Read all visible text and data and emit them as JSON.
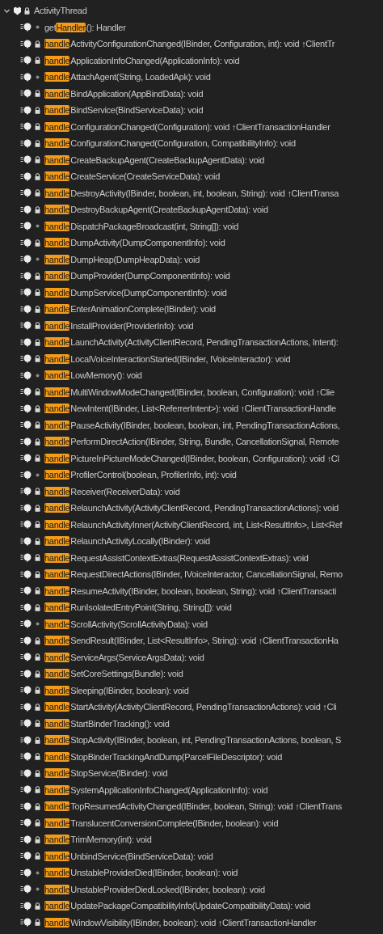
{
  "tree": {
    "label": "ActivityThread",
    "expanded": true,
    "private": true,
    "children": [
      {
        "prefix": "get",
        "match": "Handler",
        "rest": "(): Handler",
        "private": false
      },
      {
        "match": "handle",
        "rest": "ActivityConfigurationChanged(IBinder, Configuration, int): void ↑ClientTr",
        "private": true
      },
      {
        "match": "handle",
        "rest": "ApplicationInfoChanged(ApplicationInfo): void",
        "private": true
      },
      {
        "match": "handle",
        "rest": "AttachAgent(String, LoadedApk): void",
        "private": false
      },
      {
        "match": "handle",
        "rest": "BindApplication(AppBindData): void",
        "private": true
      },
      {
        "match": "handle",
        "rest": "BindService(BindServiceData): void",
        "private": true
      },
      {
        "match": "handle",
        "rest": "ConfigurationChanged(Configuration): void ↑ClientTransactionHandler",
        "private": true
      },
      {
        "match": "handle",
        "rest": "ConfigurationChanged(Configuration, CompatibilityInfo): void",
        "private": true
      },
      {
        "match": "handle",
        "rest": "CreateBackupAgent(CreateBackupAgentData): void",
        "private": true
      },
      {
        "match": "handle",
        "rest": "CreateService(CreateServiceData): void",
        "private": true
      },
      {
        "match": "handle",
        "rest": "DestroyActivity(IBinder, boolean, int, boolean, String): void ↑ClientTransa",
        "private": true
      },
      {
        "match": "handle",
        "rest": "DestroyBackupAgent(CreateBackupAgentData): void",
        "private": true
      },
      {
        "match": "handle",
        "rest": "DispatchPackageBroadcast(int, String[]): void",
        "private": false
      },
      {
        "match": "handle",
        "rest": "DumpActivity(DumpComponentInfo): void",
        "private": true
      },
      {
        "match": "handle",
        "rest": "DumpHeap(DumpHeapData): void",
        "private": false
      },
      {
        "match": "handle",
        "rest": "DumpProvider(DumpComponentInfo): void",
        "private": true
      },
      {
        "match": "handle",
        "rest": "DumpService(DumpComponentInfo): void",
        "private": true
      },
      {
        "match": "handle",
        "rest": "EnterAnimationComplete(IBinder): void",
        "private": true
      },
      {
        "match": "handle",
        "rest": "InstallProvider(ProviderInfo): void",
        "private": true
      },
      {
        "match": "handle",
        "rest": "LaunchActivity(ActivityClientRecord, PendingTransactionActions, Intent):",
        "private": true
      },
      {
        "match": "handle",
        "rest": "LocalVoiceInteractionStarted(IBinder, IVoiceInteractor): void",
        "private": true
      },
      {
        "match": "handle",
        "rest": "LowMemory(): void",
        "private": false
      },
      {
        "match": "handle",
        "rest": "MultiWindowModeChanged(IBinder, boolean, Configuration): void ↑Clie",
        "private": true
      },
      {
        "match": "handle",
        "rest": "NewIntent(IBinder, List<ReferrerIntent>): void ↑ClientTransactionHandle",
        "private": true
      },
      {
        "match": "handle",
        "rest": "PauseActivity(IBinder, boolean, boolean, int, PendingTransactionActions,",
        "private": true
      },
      {
        "match": "handle",
        "rest": "PerformDirectAction(IBinder, String, Bundle, CancellationSignal, Remote",
        "private": true
      },
      {
        "match": "handle",
        "rest": "PictureInPictureModeChanged(IBinder, boolean, Configuration): void ↑Cl",
        "private": true
      },
      {
        "match": "handle",
        "rest": "ProfilerControl(boolean, ProfilerInfo, int): void",
        "private": false
      },
      {
        "match": "handle",
        "rest": "Receiver(ReceiverData): void",
        "private": true
      },
      {
        "match": "handle",
        "rest": "RelaunchActivity(ActivityClientRecord, PendingTransactionActions): void",
        "private": true
      },
      {
        "match": "handle",
        "rest": "RelaunchActivityInner(ActivityClientRecord, int, List<ResultInfo>, List<Ref",
        "private": true
      },
      {
        "match": "handle",
        "rest": "RelaunchActivityLocally(IBinder): void",
        "private": true
      },
      {
        "match": "handle",
        "rest": "RequestAssistContextExtras(RequestAssistContextExtras): void",
        "private": true
      },
      {
        "match": "handle",
        "rest": "RequestDirectActions(IBinder, IVoiceInteractor, CancellationSignal, Remo",
        "private": true
      },
      {
        "match": "handle",
        "rest": "ResumeActivity(IBinder, boolean, boolean, String): void ↑ClientTransacti",
        "private": true
      },
      {
        "match": "handle",
        "rest": "RunIsolatedEntryPoint(String, String[]): void",
        "private": true
      },
      {
        "match": "handle",
        "rest": "ScrollActivity(ScrollActivityData): void",
        "private": false
      },
      {
        "match": "handle",
        "rest": "SendResult(IBinder, List<ResultInfo>, String): void ↑ClientTransactionHa",
        "private": true
      },
      {
        "match": "handle",
        "rest": "ServiceArgs(ServiceArgsData): void",
        "private": true
      },
      {
        "match": "handle",
        "rest": "SetCoreSettings(Bundle): void",
        "private": true
      },
      {
        "match": "handle",
        "rest": "Sleeping(IBinder, boolean): void",
        "private": true
      },
      {
        "match": "handle",
        "rest": "StartActivity(ActivityClientRecord, PendingTransactionActions): void ↑Cli",
        "private": true
      },
      {
        "match": "handle",
        "rest": "StartBinderTracking(): void",
        "private": true
      },
      {
        "match": "handle",
        "rest": "StopActivity(IBinder, boolean, int, PendingTransactionActions, boolean, S",
        "private": true
      },
      {
        "match": "handle",
        "rest": "StopBinderTrackingAndDump(ParcelFileDescriptor): void",
        "private": true
      },
      {
        "match": "handle",
        "rest": "StopService(IBinder): void",
        "private": true
      },
      {
        "match": "handle",
        "rest": "SystemApplicationInfoChanged(ApplicationInfo): void",
        "private": true
      },
      {
        "match": "handle",
        "rest": "TopResumedActivityChanged(IBinder, boolean, String): void ↑ClientTrans",
        "private": true
      },
      {
        "match": "handle",
        "rest": "TranslucentConversionComplete(IBinder, boolean): void",
        "private": true
      },
      {
        "match": "handle",
        "rest": "TrimMemory(int): void",
        "private": true
      },
      {
        "match": "handle",
        "rest": "UnbindService(BindServiceData): void",
        "private": true
      },
      {
        "match": "handle",
        "rest": "UnstableProviderDied(IBinder, boolean): void",
        "private": false
      },
      {
        "match": "handle",
        "rest": "UnstableProviderDiedLocked(IBinder, boolean): void",
        "private": false
      },
      {
        "match": "handle",
        "rest": "UpdatePackageCompatibilityInfo(UpdateCompatibilityData): void",
        "private": true
      },
      {
        "match": "handle",
        "rest": "WindowVisibility(IBinder, boolean): void ↑ClientTransactionHandler",
        "private": true
      }
    ]
  }
}
